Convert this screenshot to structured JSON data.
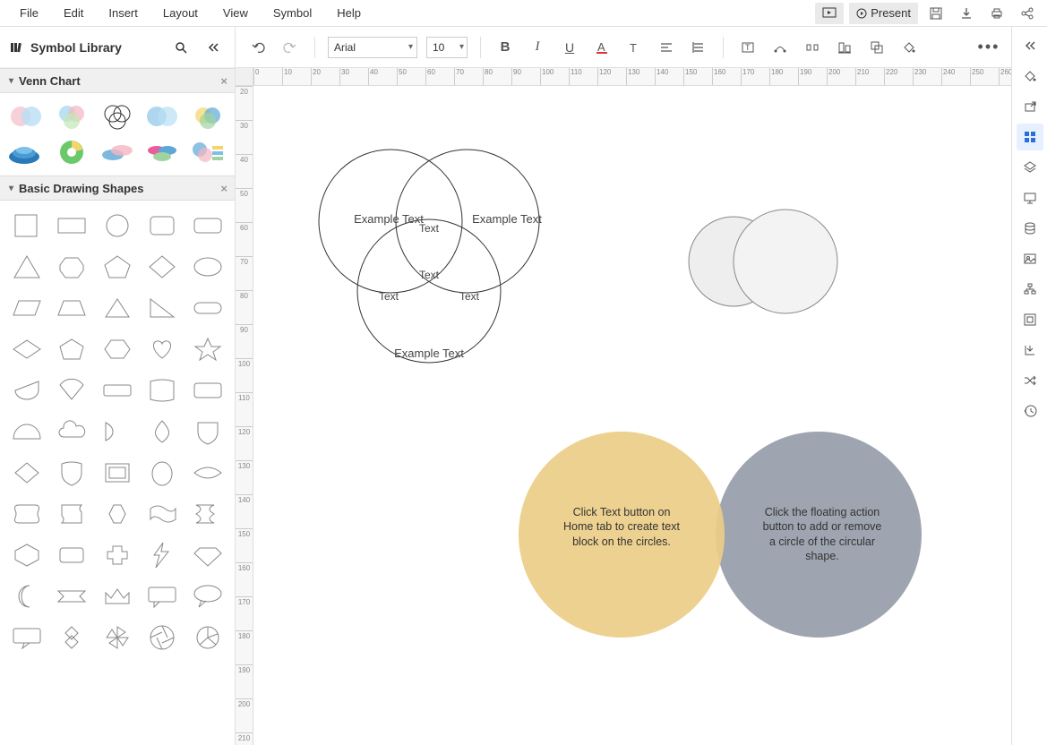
{
  "menu": [
    "File",
    "Edit",
    "Insert",
    "Layout",
    "View",
    "Symbol",
    "Help"
  ],
  "topright": {
    "present": "Present"
  },
  "leftHeader": {
    "title": "Symbol Library"
  },
  "sections": {
    "venn": "Venn Chart",
    "basic": "Basic Drawing Shapes"
  },
  "toolbar": {
    "font": "Arial",
    "size": "10"
  },
  "canvas": {
    "venn1": {
      "topLeft": "Example Text",
      "topRight": "Example Text",
      "bottom": "Example Text",
      "centerTop": "Text",
      "center": "Text",
      "centerLeft": "Text",
      "centerRight": "Text"
    },
    "venn2": {
      "left": "Click Text button on Home tab to create text block on the circles.",
      "right": "Click the floating action button to add or remove a circle of the circular shape."
    }
  },
  "rulerH": [
    "0",
    "10",
    "20",
    "30",
    "40",
    "50",
    "60",
    "70",
    "80",
    "90",
    "100",
    "110",
    "120",
    "130",
    "140",
    "150",
    "160",
    "170",
    "180",
    "190",
    "200",
    "210",
    "220",
    "230",
    "240",
    "250",
    "260"
  ],
  "rulerV": [
    "20",
    "30",
    "40",
    "50",
    "60",
    "70",
    "80",
    "90",
    "100",
    "110",
    "120",
    "130",
    "140",
    "150",
    "160",
    "170",
    "180",
    "190",
    "200",
    "210"
  ]
}
